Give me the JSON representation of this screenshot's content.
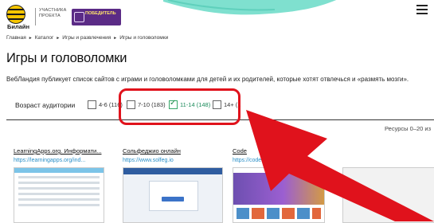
{
  "header": {
    "brand_name": "Билайн",
    "participant_line1": "УЧАСТНИКА",
    "participant_line2": "ПРОЕКТА",
    "badge_text": "ПОБЕДИТЕЛЬ",
    "badge_color": "#5b2b86",
    "brand_color": "#f7c600"
  },
  "breadcrumb": [
    "Главная",
    "Каталог",
    "Игры и развлечения",
    "Игры и головоломки"
  ],
  "page": {
    "title": "Игры и головоломки",
    "intro": "ВебЛандия публикует список сайтов с играми и головоломками для детей и их родителей, которые хотят отвлечься и «размять мозги»."
  },
  "filters": {
    "label": "Возраст аудитории",
    "options": [
      {
        "label": "4-6 (116)",
        "checked": false
      },
      {
        "label": "7-10 (183)",
        "checked": false
      },
      {
        "label": "11-14 (148)",
        "checked": true
      },
      {
        "label": "14+ (1",
        "checked": false
      }
    ]
  },
  "results_text": "Ресурсы 0–20 из",
  "cards": [
    {
      "title": "LearningApps.org. Информати...",
      "url": "https://learningapps.org/ind..."
    },
    {
      "title": "Сольфеджио онлайн",
      "url": "https://www.solfeg.io"
    },
    {
      "title": "Code",
      "url": "https://code.org"
    }
  ],
  "annotation_color": "#e0121c",
  "link_color": "#2b8fc7"
}
